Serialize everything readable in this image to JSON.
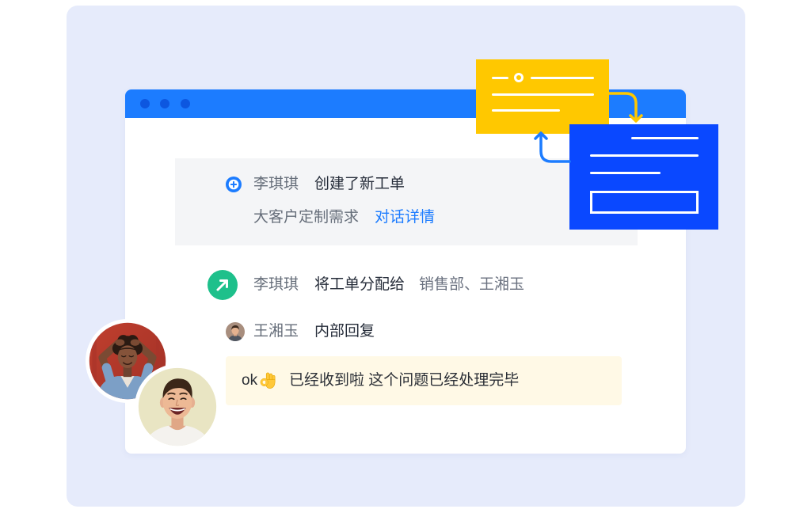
{
  "colors": {
    "backdrop": "#E6EBFB",
    "window_bar": "#1C7CFF",
    "window_dots": "#0D57E0",
    "accent_blue": "#1C7CFF",
    "card_yellow": "#FFC800",
    "card_blue": "#0A48FF",
    "status_green": "#1EC08B",
    "note_bg": "#FFF9E6"
  },
  "window": {
    "controls": [
      "window-dot-icon",
      "window-dot-icon",
      "window-dot-icon"
    ]
  },
  "decorations": {
    "cards": [
      "document-card-icon",
      "form-card-icon"
    ],
    "arrows": [
      "curved-arrow-down-icon",
      "curved-arrow-up-icon"
    ],
    "avatars": [
      "woman-avatar",
      "man-avatar"
    ]
  },
  "timeline": {
    "created": {
      "icon": "plus-circle-icon",
      "user": "李琪琪",
      "action": "创建了新工单",
      "ticket_title": "大客户定制需求",
      "link": "对话详情"
    },
    "assigned": {
      "icon": "arrow-up-right-icon",
      "user": "李琪琪",
      "action": "将工单分配给",
      "assignees": "销售部、王湘玉"
    },
    "reply": {
      "icon": "user-avatar",
      "user": "王湘玉",
      "action": "内部回复",
      "message_prefix": "ok",
      "message_emoji": "ok-hand-emoji-icon",
      "message": "已经收到啦 这个问题已经处理完毕"
    }
  }
}
